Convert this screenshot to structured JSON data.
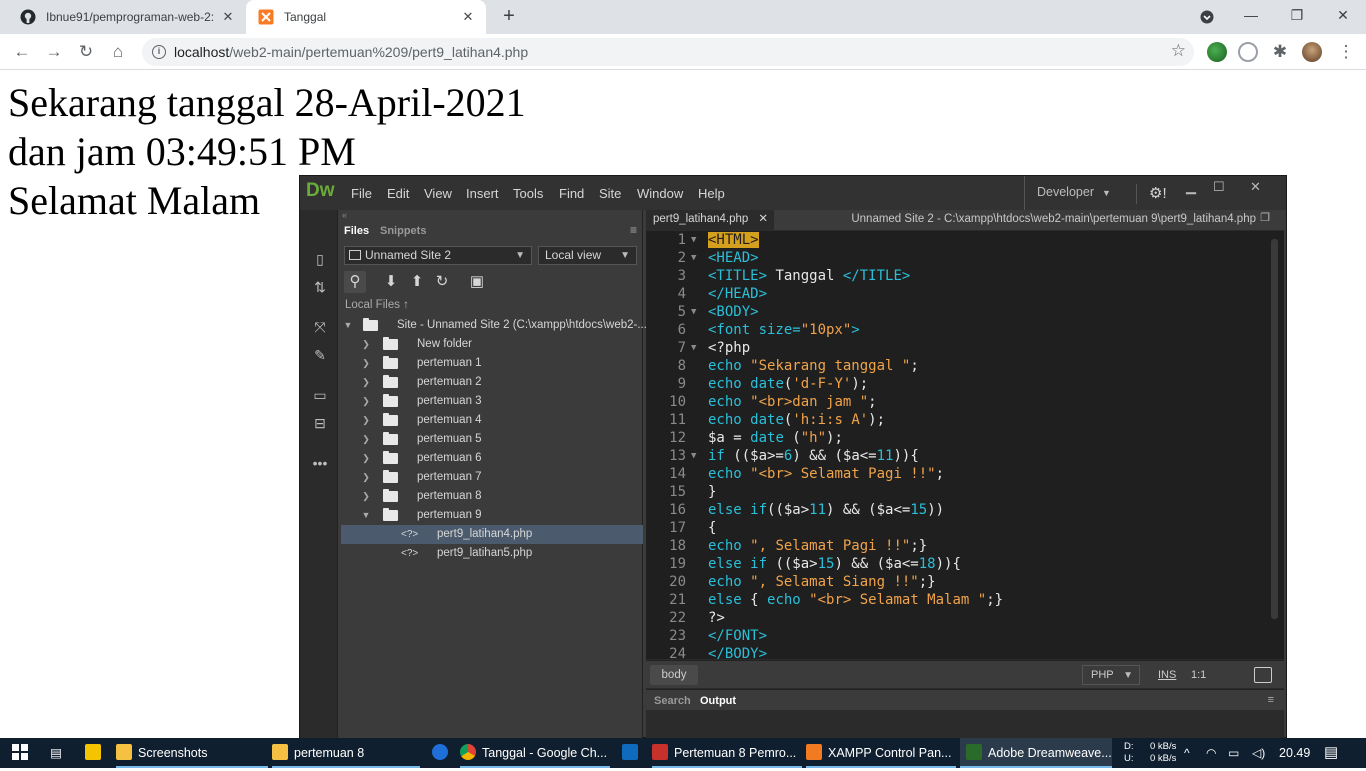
{
  "browser": {
    "tabs": [
      {
        "title": "Ibnue91/pemprograman-web-2:",
        "favicon": "github-icon",
        "active": false
      },
      {
        "title": "Tanggal",
        "favicon": "xampp-icon",
        "active": true
      }
    ],
    "new_tab": "+",
    "address": {
      "host": "localhost",
      "path": "/web2-main/pertemuan%209/pert9_latihan4.php"
    }
  },
  "page": {
    "lines": [
      "Sekarang tanggal 28-April-2021",
      "dan jam 03:49:51 PM",
      "Selamat Malam"
    ]
  },
  "dreamweaver": {
    "logo": "Dw",
    "menu": [
      "File",
      "Edit",
      "View",
      "Insert",
      "Tools",
      "Find",
      "Site",
      "Window",
      "Help"
    ],
    "workspace": "Developer",
    "files_panel": {
      "tabs": [
        "Files",
        "Snippets"
      ],
      "site": "Unnamed Site 2",
      "view": "Local view",
      "local_files_label": "Local Files",
      "root": "Site - Unnamed Site 2 (C:\\xampp\\htdocs\\web2-...",
      "folders": [
        "New folder",
        "pertemuan 1",
        "pertemuan 2",
        "pertemuan 3",
        "pertemuan 4",
        "pertemuan 5",
        "pertemuan 6",
        "pertemuan 7",
        "pertemuan 8",
        "pertemuan 9"
      ],
      "files": [
        {
          "name": "pert9_latihan4.php",
          "selected": true
        },
        {
          "name": "pert9_latihan5.php",
          "selected": false
        }
      ]
    },
    "document": {
      "tab": "pert9_latihan4.php",
      "path": "Unnamed Site 2 - C:\\xampp\\htdocs\\web2-main\\pertemuan 9\\pert9_latihan4.php"
    },
    "code_lines": [
      {
        "n": "1",
        "fold": true,
        "t": "<HTML>"
      },
      {
        "n": "2",
        "fold": true,
        "t": "<HEAD>"
      },
      {
        "n": "3",
        "fold": false,
        "t": "<TITLE> Tanggal </TITLE>"
      },
      {
        "n": "4",
        "fold": false,
        "t": "</HEAD>"
      },
      {
        "n": "5",
        "fold": true,
        "t": "<BODY>"
      },
      {
        "n": "6",
        "fold": false,
        "t": "<font size=\"10px\">"
      },
      {
        "n": "7",
        "fold": true,
        "t": "<?php"
      },
      {
        "n": "8",
        "fold": false,
        "t": "echo \"Sekarang tanggal \";"
      },
      {
        "n": "9",
        "fold": false,
        "t": "echo date('d-F-Y');"
      },
      {
        "n": "10",
        "fold": false,
        "t": "echo \"<br>dan jam \";"
      },
      {
        "n": "11",
        "fold": false,
        "t": "echo date('h:i:s A');"
      },
      {
        "n": "12",
        "fold": false,
        "t": "$a = date (\"h\");"
      },
      {
        "n": "13",
        "fold": true,
        "t": "if (($a>=6) && ($a<=11)){"
      },
      {
        "n": "14",
        "fold": false,
        "t": "echo \"<br> Selamat Pagi !!\";"
      },
      {
        "n": "15",
        "fold": false,
        "t": "}"
      },
      {
        "n": "16",
        "fold": false,
        "t": "else if(($a>11) && ($a<=15))"
      },
      {
        "n": "17",
        "fold": false,
        "t": "{"
      },
      {
        "n": "18",
        "fold": false,
        "t": "echo \", Selamat Pagi !!\";}"
      },
      {
        "n": "19",
        "fold": false,
        "t": "else if (($a>15) && ($a<=18)){"
      },
      {
        "n": "20",
        "fold": false,
        "t": "echo \", Selamat Siang !!\";}"
      },
      {
        "n": "21",
        "fold": false,
        "t": "else { echo \"<br> Selamat Malam \";}"
      },
      {
        "n": "22",
        "fold": false,
        "t": "?>"
      },
      {
        "n": "23",
        "fold": false,
        "t": "</FONT>"
      },
      {
        "n": "24",
        "fold": false,
        "t": "</BODY>"
      }
    ],
    "status": {
      "tag": "body",
      "language": "PHP",
      "mode": "INS",
      "position": "1:1"
    },
    "output_panel": {
      "tabs": [
        "Search",
        "Output"
      ]
    }
  },
  "taskbar": {
    "items": [
      {
        "label": "Screenshots",
        "color": "#f5c142"
      },
      {
        "label": "pertemuan 8",
        "color": "#f5c142"
      },
      {
        "label": "",
        "color": "#1e6fd9"
      },
      {
        "label": "Tanggal - Google Ch...",
        "color": "#e8c33a"
      },
      {
        "label": "",
        "color": "#0f6cbd"
      },
      {
        "label": "Pertemuan 8 Pemro...",
        "color": "#c8312b"
      },
      {
        "label": "XAMPP Control Pan...",
        "color": "#f27b21"
      },
      {
        "label": "Adobe Dreamweave...",
        "color": "#2a6a2a"
      }
    ],
    "network": {
      "down_label": "D:",
      "down": "0 kB/s",
      "up_label": "U:",
      "up": "0 kB/s"
    },
    "clock": "20.49"
  },
  "colors": {
    "tag": "#2bbfd9",
    "string": "#f0a34a",
    "highlight": "#d4a01e",
    "dw_bg": "#3b3b3b",
    "editor_bg": "#1f1f1f"
  }
}
